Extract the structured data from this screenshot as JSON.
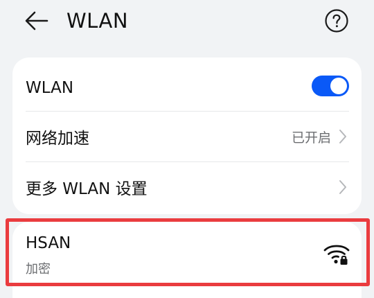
{
  "header": {
    "title": "WLAN",
    "back_icon": "arrow-left-icon",
    "help_icon": "help-circle-icon"
  },
  "settings": {
    "wlan_label": "WLAN",
    "wlan_enabled": true,
    "accelerate_label": "网络加速",
    "accelerate_value": "已开启",
    "more_settings_label": "更多 WLAN 设置"
  },
  "networks": [
    {
      "name": "HSAN",
      "security": "加密",
      "signal_icon": "wifi-lock-icon"
    }
  ],
  "colors": {
    "accent": "#0a59f7",
    "highlight": "#ea3c3f",
    "background": "#f1f3f5"
  }
}
